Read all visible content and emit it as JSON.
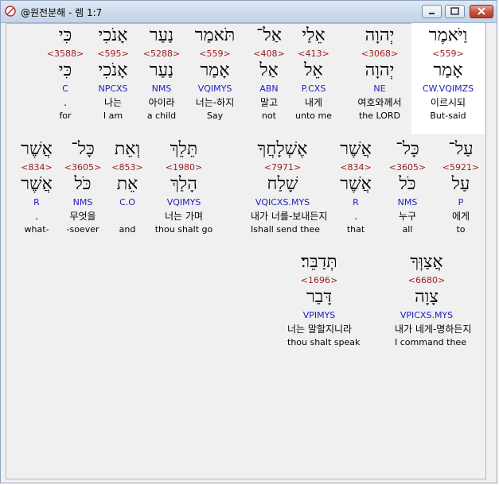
{
  "window": {
    "title": "@원전분해 - 렘 1:7"
  },
  "words": [
    {
      "heb": "וַיֹּאמֶר",
      "strong": "<559>",
      "lemma": "אָמַר",
      "morph": "CW.VQIMZS",
      "kor": "이르시되",
      "eng": "But-said",
      "highlighted": true
    },
    {
      "heb": "יְהוָה",
      "strong": "<3068>",
      "lemma": "יְהוָה",
      "morph": "NE",
      "kor": "여호와께서",
      "eng": "the LORD"
    },
    {
      "heb": "אֵלַי",
      "strong": "<413>",
      "lemma": "אֵל",
      "morph": "P.CXS",
      "kor": "내게",
      "eng": "unto me"
    },
    {
      "heb": "אַל־",
      "strong": "<408>",
      "lemma": "אַל",
      "morph": "ABN",
      "kor": "말고",
      "eng": "not"
    },
    {
      "heb": "תֹּאמַר",
      "strong": "<559>",
      "lemma": "אָמַר",
      "morph": "VQIMYS",
      "kor": "너는-하지",
      "eng": "Say"
    },
    {
      "heb": "נַעַר",
      "strong": "<5288>",
      "lemma": "נַעַר",
      "morph": "NMS",
      "kor": "아이라",
      "eng": "a child"
    },
    {
      "heb": "אָנֹכִי",
      "strong": "<595>",
      "lemma": "אָנֹכִי",
      "morph": "NPCXS",
      "kor": "나는",
      "eng": "I am"
    },
    {
      "heb": "כִּי",
      "strong": "<3588>",
      "lemma": "כִּי",
      "morph": "C",
      "kor": ".",
      "eng": "for"
    },
    {
      "heb": "עַל־",
      "strong": "<5921>",
      "lemma": "עַל",
      "morph": "P",
      "kor": "에게",
      "eng": "to"
    },
    {
      "heb": "כָּל־",
      "strong": "<3605>",
      "lemma": "כֹּל",
      "morph": "NMS",
      "kor": "누구",
      "eng": "all"
    },
    {
      "heb": "אֲשֶׁר",
      "strong": "<834>",
      "lemma": "אֲשֶׁר",
      "morph": "R",
      "kor": ".",
      "eng": "that"
    },
    {
      "heb": "אֶשְׁלָחֲךָ",
      "strong": "<7971>",
      "lemma": "שָׁלַח",
      "morph": "VQICXS.MYS",
      "kor": "내가 너를-보내든지",
      "eng": "Ishall send thee"
    },
    {
      "heb": "תֵּלֵךְ",
      "strong": "<1980>",
      "lemma": "הָלַךְ",
      "morph": "VQIMYS",
      "kor": "너는 가며",
      "eng": "thou shalt go"
    },
    {
      "heb": "וְאֵת",
      "strong": "<853>",
      "lemma": "אֵת",
      "morph": "C.O",
      "kor": "",
      "eng": "and"
    },
    {
      "heb": "כָּל־",
      "strong": "<3605>",
      "lemma": "כֹּל",
      "morph": "NMS",
      "kor": "무엇을",
      "eng": "-soever"
    },
    {
      "heb": "אֲשֶׁר",
      "strong": "<834>",
      "lemma": "אֲשֶׁר",
      "morph": "R",
      "kor": ".",
      "eng": "what-"
    },
    {
      "heb": "אֲצַוְּךָ",
      "strong": "<6680>",
      "lemma": "צָוָה",
      "morph": "VPICXS.MYS",
      "kor": "내가 네게-명하든지",
      "eng": "I command thee"
    },
    {
      "heb": "תְּדַבֵּר׃",
      "strong": "<1696>",
      "lemma": "דָּבַר",
      "morph": "VPIMYS",
      "kor": "너는 말할지니라",
      "eng": "thou shalt speak"
    }
  ]
}
